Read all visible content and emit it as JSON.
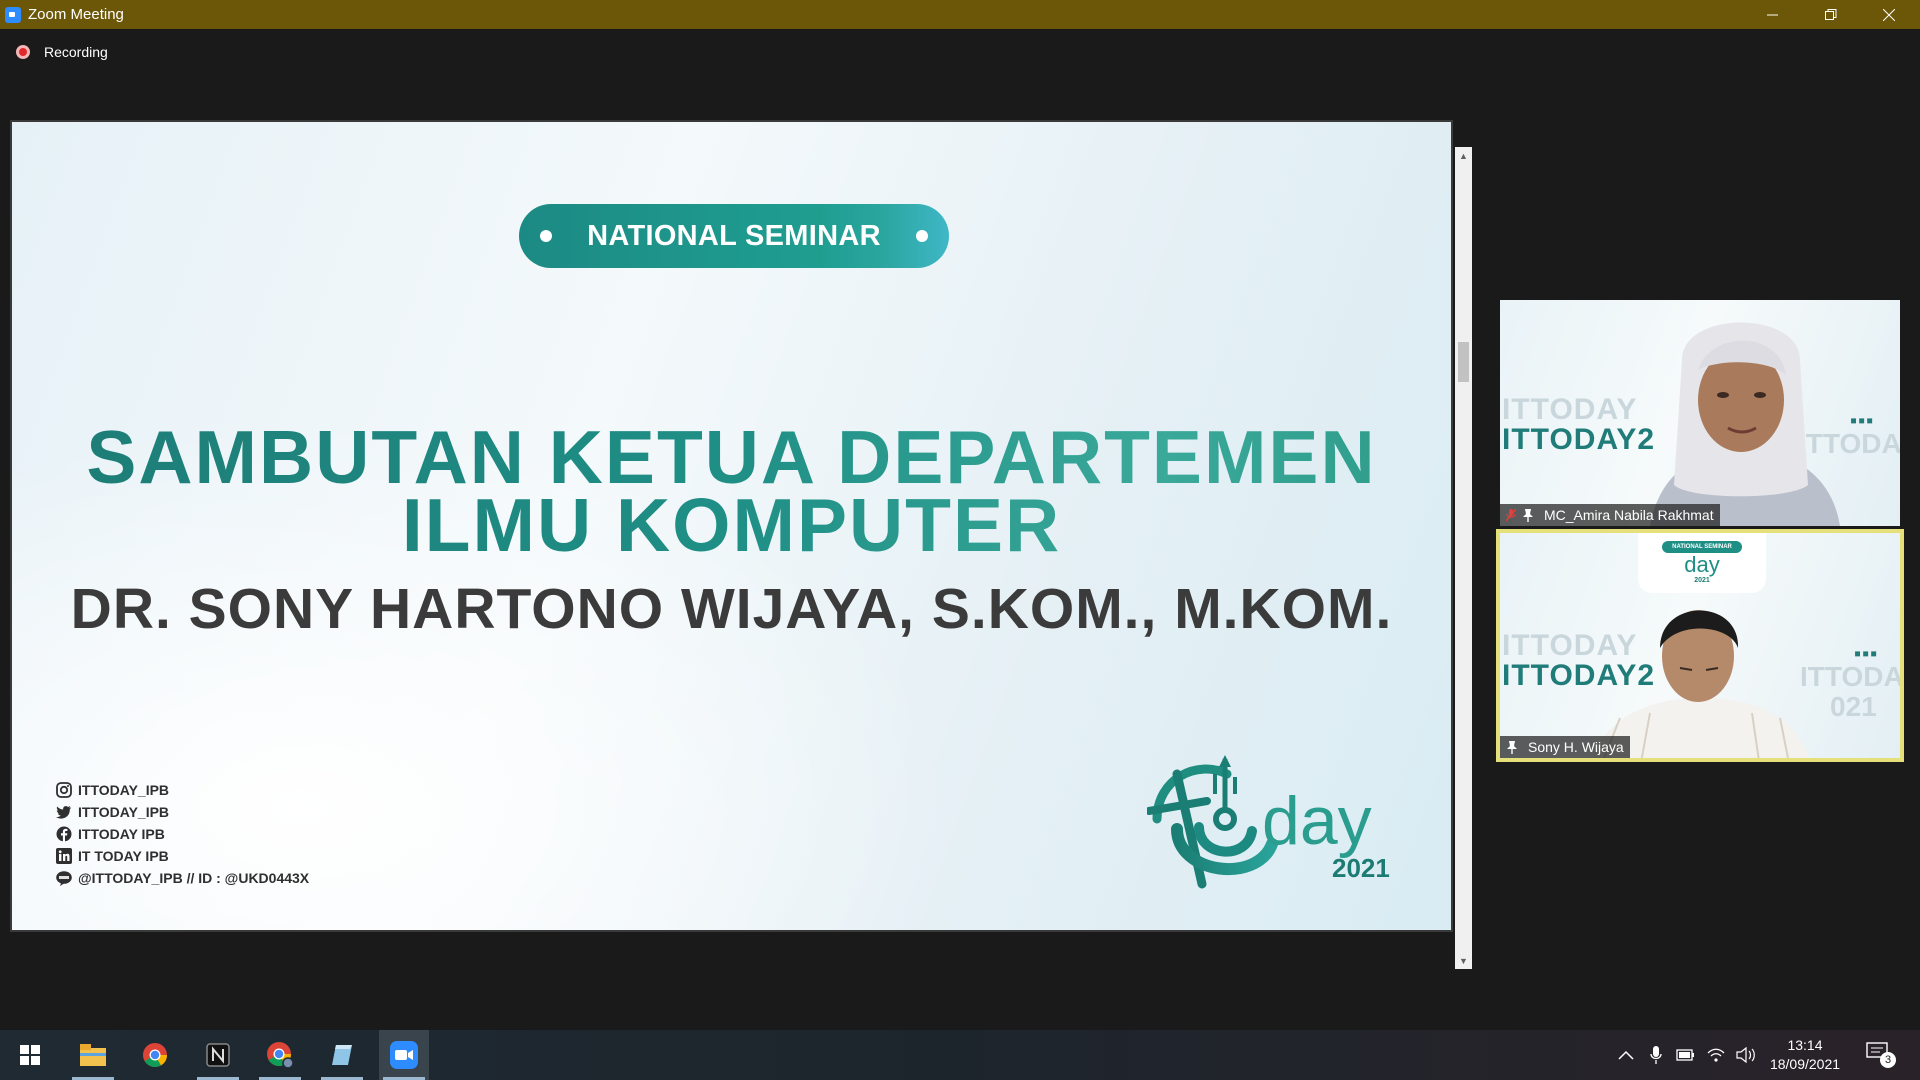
{
  "window": {
    "title": "Zoom Meeting",
    "minimize_icon": "minimize-icon",
    "maximize_icon": "restore-icon",
    "close_icon": "close-icon"
  },
  "recording": {
    "label": "Recording"
  },
  "slide": {
    "badge": "NATIONAL SEMINAR",
    "heading_line1": "SAMBUTAN KETUA DEPARTEMEN",
    "heading_line2": "ILMU KOMPUTER",
    "speaker": "DR. SONY HARTONO WIJAYA, S.KOM., M.KOM.",
    "socials": [
      {
        "icon": "instagram-icon",
        "text": "ITTODAY_IPB"
      },
      {
        "icon": "twitter-icon",
        "text": "ITTODAY_IPB"
      },
      {
        "icon": "facebook-icon",
        "text": "ITTODAY IPB"
      },
      {
        "icon": "linkedin-icon",
        "text": "IT TODAY IPB"
      },
      {
        "icon": "line-icon",
        "text": "@ITTODAY_IPB // ID : @UKD0443X"
      }
    ],
    "logo_word": "day",
    "logo_year": "2021",
    "colors": {
      "teal": "#1f8f86",
      "teal_dark": "#1d7c76",
      "text_dark": "#3b3b3b"
    }
  },
  "participants": [
    {
      "name": "MC_Amira Nabila Rakhmat",
      "muted": true,
      "active_speaker": false
    },
    {
      "name": "Sony H. Wijaya",
      "muted": false,
      "active_speaker": true
    }
  ],
  "participant_background": {
    "watermark": "ITTODAY2",
    "watermark_faint": "ITTODAY",
    "watermark_right": "ITTODAY",
    "watermark_small": "021",
    "slide_badge": "NATIONAL SEMINAR",
    "slide_logo": "day",
    "slide_logo_year": "2021"
  },
  "taskbar": {
    "apps": [
      "start-button",
      "file-explorer-icon",
      "chrome-icon",
      "notion-icon",
      "chrome-profile-icon",
      "notepad-icon",
      "zoom-icon"
    ],
    "time": "13:14",
    "date": "18/09/2021",
    "notification_count": "3"
  }
}
